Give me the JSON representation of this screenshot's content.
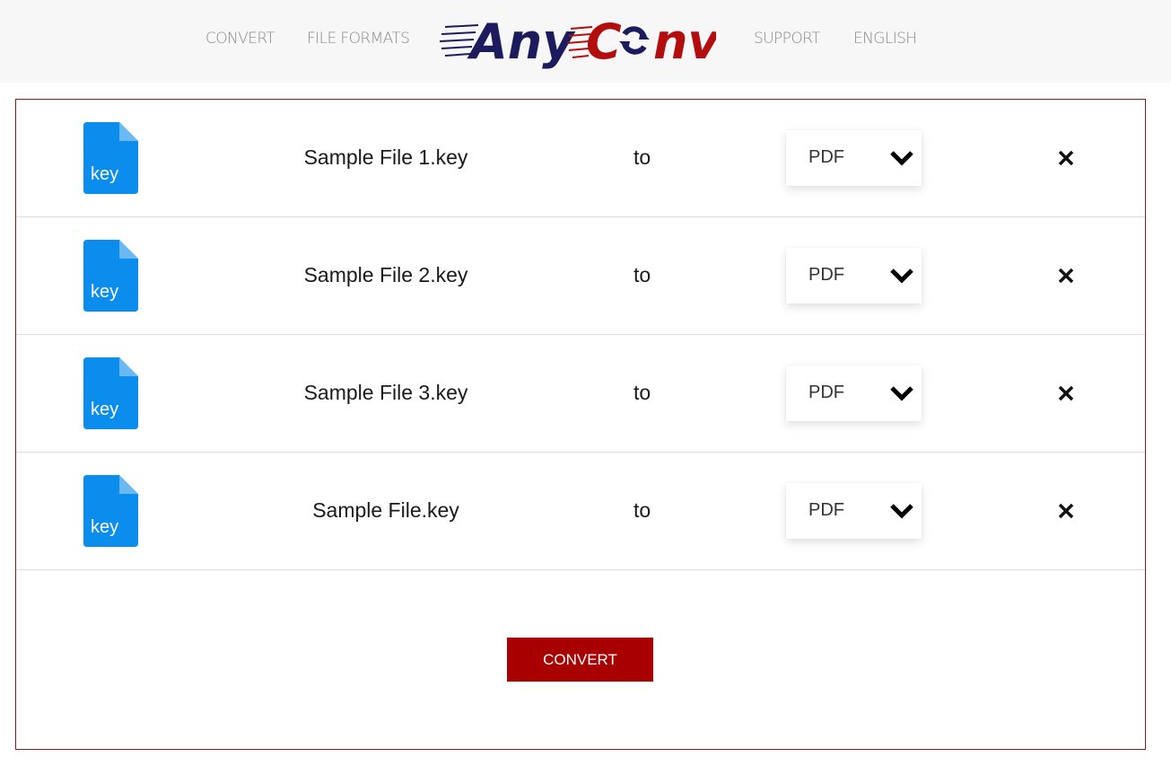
{
  "header": {
    "nav_left": [
      {
        "label": "CONVERT"
      },
      {
        "label": "FILE FORMATS"
      }
    ],
    "logo": {
      "part1": "Any",
      "part2": "C",
      "part3": "nv",
      "color_primary": "#1b1b5e",
      "color_accent": "#b30d0d"
    },
    "nav_right": [
      {
        "label": "SUPPORT"
      },
      {
        "label": "ENGLISH"
      }
    ]
  },
  "files": [
    {
      "icon": "key-file-icon",
      "ext": "key",
      "name": "Sample File 1.key",
      "to": "to",
      "format": "PDF"
    },
    {
      "icon": "key-file-icon",
      "ext": "key",
      "name": "Sample File 2.key",
      "to": "to",
      "format": "PDF"
    },
    {
      "icon": "key-file-icon",
      "ext": "key",
      "name": "Sample File 3.key",
      "to": "to",
      "format": "PDF"
    },
    {
      "icon": "key-file-icon",
      "ext": "key",
      "name": "Sample File.key",
      "to": "to",
      "format": "PDF"
    }
  ],
  "convert_button": {
    "label": "CONVERT",
    "color": "#a80000"
  },
  "colors": {
    "file_icon": "#0a8ded",
    "panel_border": "#8b1a1a"
  }
}
